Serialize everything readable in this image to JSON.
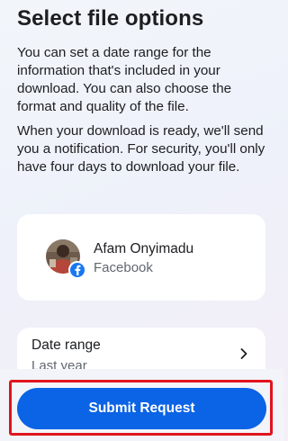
{
  "header": {
    "title": "Select file options"
  },
  "body": {
    "paragraph_1": "You can set a date range for the information that's included in your download. You can also choose the format and quality of the file.",
    "paragraph_2": "When your download is ready, we'll send you a notification. For security, you'll only have four days to download your file."
  },
  "account": {
    "name": "Afam Onyimadu",
    "platform": "Facebook",
    "badge_icon": "facebook-icon",
    "brand_color": "#1877f2"
  },
  "date_range": {
    "label": "Date range",
    "value": "Last year",
    "icon": "chevron-right-icon"
  },
  "footer": {
    "submit_label": "Submit Request",
    "button_color": "#0b63e5",
    "highlight_color": "#e0141e"
  }
}
